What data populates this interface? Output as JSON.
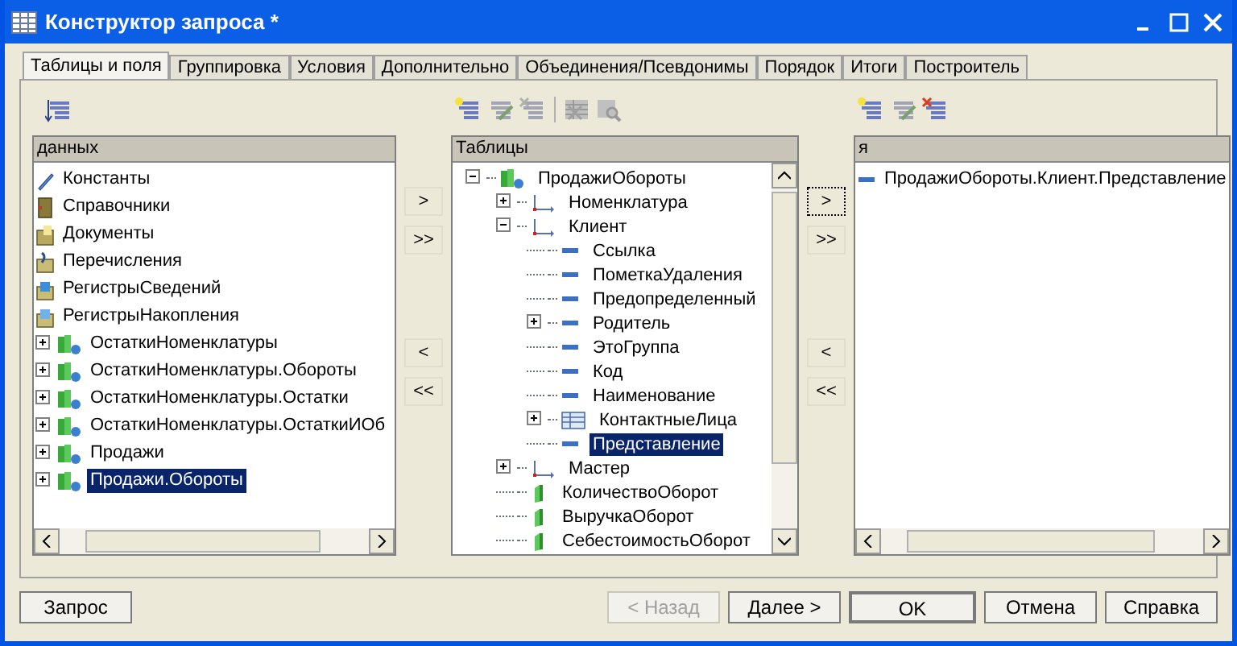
{
  "window": {
    "title": "Конструктор запроса *"
  },
  "tabs": [
    {
      "label": "Таблицы и поля",
      "selected": true
    },
    {
      "label": "Группировка",
      "selected": false
    },
    {
      "label": "Условия",
      "selected": false
    },
    {
      "label": "Дополнительно",
      "selected": false
    },
    {
      "label": "Объединения/Псевдонимы",
      "selected": false
    },
    {
      "label": "Порядок",
      "selected": false
    },
    {
      "label": "Итоги",
      "selected": false
    },
    {
      "label": "Построитель",
      "selected": false
    }
  ],
  "sources": {
    "heading": "данных",
    "items": [
      {
        "label": "Константы",
        "kind": "constants",
        "selected": false
      },
      {
        "label": "Справочники",
        "kind": "catalogs",
        "selected": false
      },
      {
        "label": "Документы",
        "kind": "documents",
        "selected": false
      },
      {
        "label": "Перечисления",
        "kind": "enums",
        "selected": false
      },
      {
        "label": "РегистрыСведений",
        "kind": "info-registers",
        "selected": false
      },
      {
        "label": "РегистрыНакопления",
        "kind": "accum-registers",
        "selected": false
      },
      {
        "label": "ОстаткиНоменклатуры",
        "kind": "table",
        "expanded": false,
        "selected": false
      },
      {
        "label": "ОстаткиНоменклатуры.Обороты",
        "kind": "table",
        "expanded": false,
        "selected": false
      },
      {
        "label": "ОстаткиНоменклатуры.Остатки",
        "kind": "table",
        "expanded": false,
        "selected": false
      },
      {
        "label": "ОстаткиНоменклатуры.ОстаткиИОб",
        "kind": "table",
        "expanded": false,
        "selected": false
      },
      {
        "label": "Продажи",
        "kind": "table",
        "expanded": false,
        "selected": false
      },
      {
        "label": "Продажи.Обороты",
        "kind": "table",
        "expanded": false,
        "selected": true
      }
    ]
  },
  "source_buttons": [
    {
      "label": ">",
      "focused": false
    },
    {
      "label": ">>",
      "focused": false
    },
    {
      "label": "<",
      "focused": false
    },
    {
      "label": "<<",
      "focused": false
    }
  ],
  "tables": {
    "heading": "Таблицы",
    "items": [
      {
        "label": "ПродажиОбороты",
        "kind": "table",
        "expanded": true,
        "selected": false,
        "children": [
          {
            "label": "Номенклатура",
            "kind": "dimension",
            "expanded": false,
            "selected": false
          },
          {
            "label": "Клиент",
            "kind": "dimension",
            "expanded": true,
            "selected": false,
            "children": [
              {
                "label": "Ссылка",
                "kind": "field",
                "selected": false
              },
              {
                "label": "ПометкаУдаления",
                "kind": "field",
                "selected": false
              },
              {
                "label": "Предопределенный",
                "kind": "field",
                "selected": false
              },
              {
                "label": "Родитель",
                "kind": "field",
                "expanded": false,
                "selected": false
              },
              {
                "label": "ЭтоГруппа",
                "kind": "field",
                "selected": false
              },
              {
                "label": "Код",
                "kind": "field",
                "selected": false
              },
              {
                "label": "Наименование",
                "kind": "field",
                "selected": false
              },
              {
                "label": "КонтактныеЛица",
                "kind": "tabular",
                "expanded": false,
                "selected": false
              },
              {
                "label": "Представление",
                "kind": "field",
                "selected": true
              }
            ]
          },
          {
            "label": "Мастер",
            "kind": "dimension",
            "expanded": false,
            "selected": false
          },
          {
            "label": "КоличествоОборот",
            "kind": "resource",
            "selected": false
          },
          {
            "label": "ВыручкаОборот",
            "kind": "resource",
            "selected": false
          },
          {
            "label": "СебестоимостьОборот",
            "kind": "resource",
            "selected": false
          }
        ]
      }
    ]
  },
  "field_buttons": [
    {
      "label": ">",
      "focused": true
    },
    {
      "label": ">>",
      "focused": false
    },
    {
      "label": "<",
      "focused": false
    },
    {
      "label": "<<",
      "focused": false
    }
  ],
  "fields": {
    "heading": "я",
    "items": [
      {
        "label": "ПродажиОбороты.Клиент.Представление",
        "kind": "field",
        "selected": false
      }
    ]
  },
  "buttons": [
    {
      "label": "Запрос",
      "disabled": false,
      "default": false
    },
    {
      "label": "< Назад",
      "disabled": true,
      "default": false
    },
    {
      "label": "Далее >",
      "disabled": false,
      "default": false
    },
    {
      "label": "OK",
      "disabled": false,
      "default": true
    },
    {
      "label": "Отмена",
      "disabled": false,
      "default": false
    },
    {
      "label": "Справка",
      "disabled": false,
      "default": false
    }
  ]
}
